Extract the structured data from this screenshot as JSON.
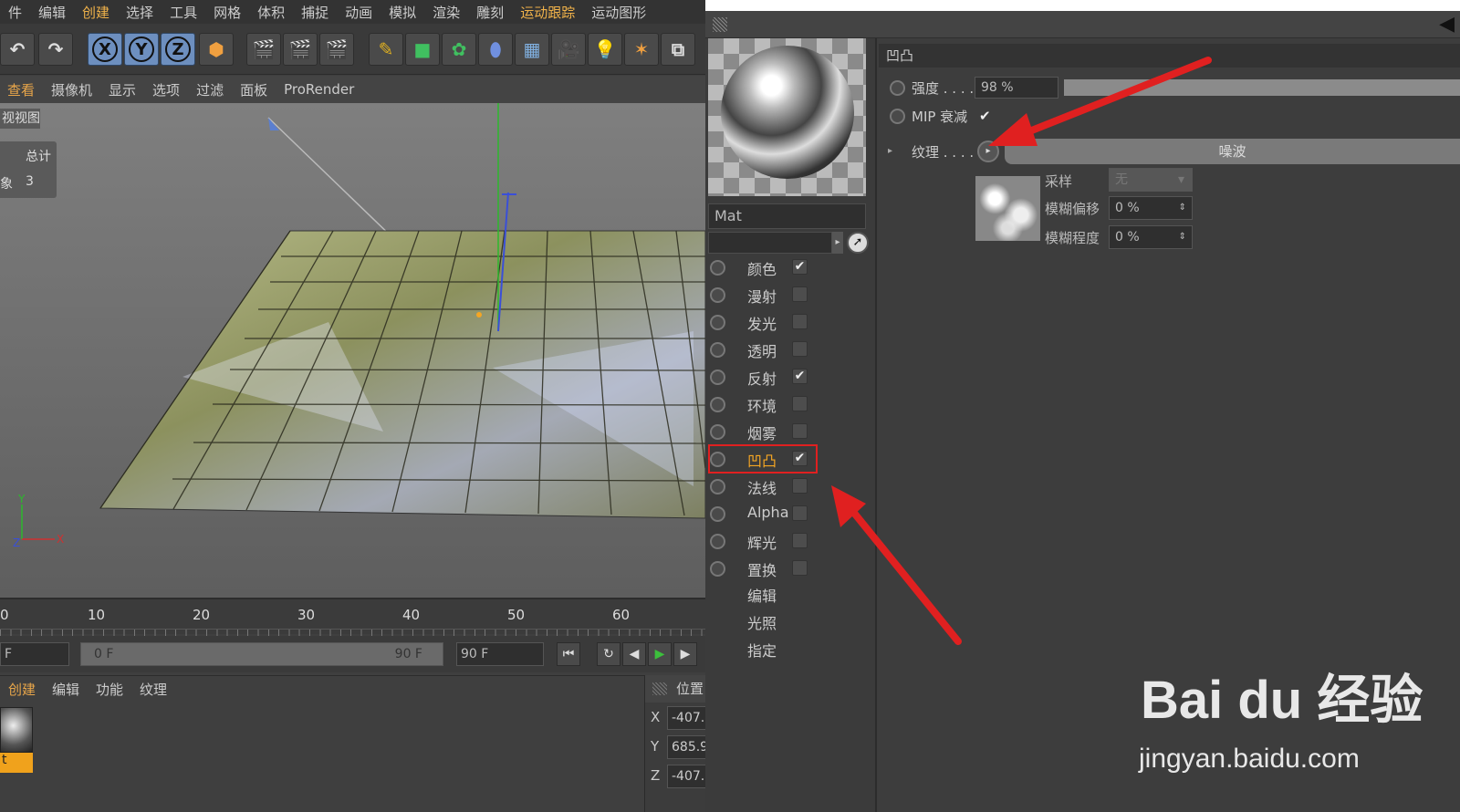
{
  "menubar": [
    "件",
    "编辑",
    "创建",
    "选择",
    "工具",
    "网格",
    "体积",
    "捕捉",
    "动画",
    "模拟",
    "渲染",
    "雕刻",
    "运动跟踪",
    "运动图形"
  ],
  "menubar_highlight": [
    2,
    12
  ],
  "axis_buttons": [
    "X",
    "Y",
    "Z"
  ],
  "viewport_menu": [
    "查看",
    "摄像机",
    "显示",
    "选项",
    "过滤",
    "面板",
    "ProRender"
  ],
  "viewport": {
    "label": "视视图",
    "stats_header": "总计",
    "stats_row_label": "象",
    "stats_row_value": "3"
  },
  "timeline": {
    "ticks": [
      "0",
      "10",
      "20",
      "30",
      "40",
      "50",
      "60"
    ]
  },
  "transport": {
    "frame_field": "F",
    "start": "0 F",
    "end": "90 F",
    "max": "90 F"
  },
  "material_manager": {
    "menu": [
      "创建",
      "编辑",
      "功能",
      "纹理"
    ],
    "material_label": "t"
  },
  "coords": {
    "title": "位置",
    "rows": [
      {
        "axis": "X",
        "value": "-407."
      },
      {
        "axis": "Y",
        "value": "685.9"
      },
      {
        "axis": "Z",
        "value": "-407."
      }
    ]
  },
  "material_editor": {
    "material_name": "Mat",
    "channels": [
      {
        "label": "颜色",
        "checked": true
      },
      {
        "label": "漫射",
        "checked": false
      },
      {
        "label": "发光",
        "checked": false
      },
      {
        "label": "透明",
        "checked": false
      },
      {
        "label": "反射",
        "checked": true
      },
      {
        "label": "环境",
        "checked": false
      },
      {
        "label": "烟雾",
        "checked": false
      },
      {
        "label": "凹凸",
        "checked": true,
        "active": true
      },
      {
        "label": "法线",
        "checked": false
      },
      {
        "label": "Alpha",
        "checked": false
      },
      {
        "label": "辉光",
        "checked": false
      },
      {
        "label": "置换",
        "checked": false
      }
    ],
    "extra_items": [
      "编辑",
      "光照",
      "指定"
    ],
    "section_title": "凹凸",
    "strength_label": "强度 . . . .",
    "strength_value": "98 %",
    "mip_label": "MIP 衰减",
    "texture_label": "纹理 . . . .",
    "texture_name": "噪波",
    "sampling_label": "采样",
    "sampling_value": "无",
    "blur_offset_label": "模糊偏移",
    "blur_offset_value": "0 %",
    "blur_scale_label": "模糊程度",
    "blur_scale_value": "0 %"
  },
  "watermark": {
    "logo": "Bai du 经验",
    "url": "jingyan.baidu.com"
  },
  "colors": {
    "accent": "#f5a623",
    "arrow": "#e02020"
  }
}
